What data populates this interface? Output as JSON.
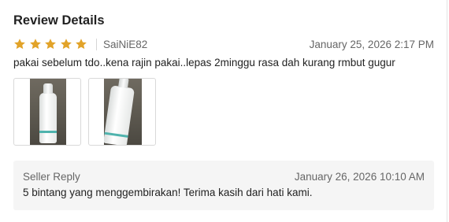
{
  "review": {
    "title": "Review Details",
    "rating": 5,
    "star_color": "#e2a329",
    "reviewer": "SaiNiE82",
    "date": "January 25, 2026 2:17 PM",
    "text": "pakai sebelum tdo..kena rajin pakai..lepas 2minggu rasa dah kurang rmbut gugur",
    "photos": [
      {
        "name": "review-photo-1",
        "icon": "product-bottle-photo"
      },
      {
        "name": "review-photo-2",
        "icon": "product-bottle-photo"
      }
    ]
  },
  "seller_reply": {
    "label": "Seller Reply",
    "date": "January 26, 2026 10:10 AM",
    "text": "5 bintang yang menggembirakan! Terima kasih dari hati kami."
  }
}
